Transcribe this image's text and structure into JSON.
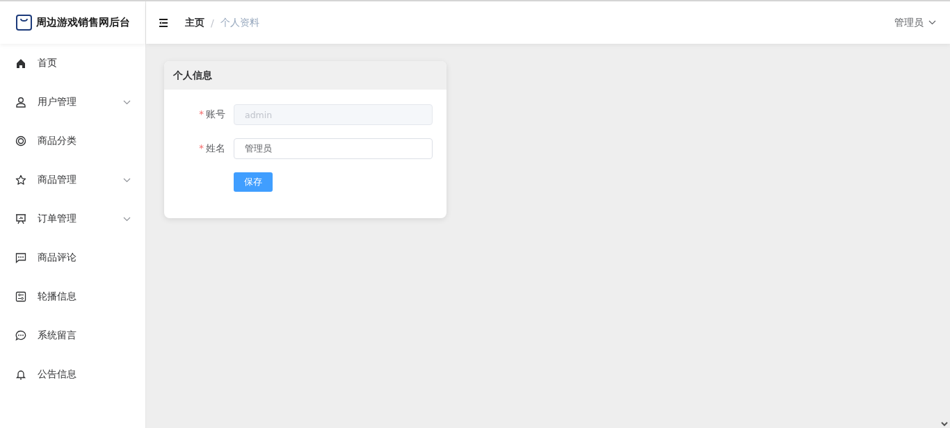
{
  "app": {
    "title": "周边游戏销售网后台"
  },
  "breadcrumb_separator": "/",
  "breadcrumb": [
    {
      "label": "主页",
      "current": false
    },
    {
      "label": "个人资料",
      "current": true
    }
  ],
  "user_menu": {
    "label": "管理员"
  },
  "sidebar": {
    "items": [
      {
        "label": "首页",
        "expandable": false
      },
      {
        "label": "用户管理",
        "expandable": true
      },
      {
        "label": "商品分类",
        "expandable": false
      },
      {
        "label": "商品管理",
        "expandable": true
      },
      {
        "label": "订单管理",
        "expandable": true
      },
      {
        "label": "商品评论",
        "expandable": false
      },
      {
        "label": "轮播信息",
        "expandable": false
      },
      {
        "label": "系统留言",
        "expandable": false
      },
      {
        "label": "公告信息",
        "expandable": false
      }
    ]
  },
  "card": {
    "title": "个人信息",
    "fields": [
      {
        "label": "账号",
        "required_mark": "*",
        "value": "admin",
        "disabled": true
      },
      {
        "label": "姓名",
        "required_mark": "*",
        "value": "管理员",
        "disabled": false
      }
    ],
    "button": "保存"
  }
}
